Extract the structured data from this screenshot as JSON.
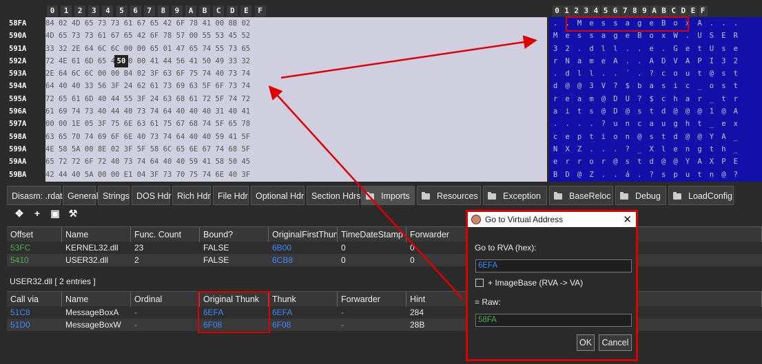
{
  "hex_header": [
    "0",
    "1",
    "2",
    "3",
    "4",
    "5",
    "6",
    "7",
    "8",
    "9",
    "A",
    "B",
    "C",
    "D",
    "E",
    "F"
  ],
  "hex_rows": [
    {
      "offset": "58FA",
      "bytes": "84 02 4D 65 73 73 61 67 65 42 6F 78 41 00 8B 02",
      "ascii": ". . M e s s a g e B o x A . . ."
    },
    {
      "offset": "590A",
      "bytes": "4D 65 73 73 61 67 65 42 6F 78 57 00 55 53 45 52",
      "ascii": "M e s s a g e B o x W . U S E R"
    },
    {
      "offset": "591A",
      "bytes": "33 32 2E 64 6C 6C 00 00 65 01 47 65 74 55 73 65",
      "ascii": "3 2 . d l l . . e . G e t U s e"
    },
    {
      "offset": "592A",
      "bytes": "72 4E 61 6D 65 41 50 00 41 44 56 41 50 49 33 32",
      "ascii": "r N a m e A . . A D V A P I 3 2"
    },
    {
      "offset": "593A",
      "bytes": "2E 64 6C 6C 00 00 B4 02 3F 63 6F 75 74 40 73 74",
      "ascii": ". d l l . . ´ . ? c o u t @ s t"
    },
    {
      "offset": "594A",
      "bytes": "64 40 40 33 56 3F 24 62 61 73 69 63 5F 6F 73 74",
      "ascii": "d @ @ 3 V ? $ b a s i c _ o s t"
    },
    {
      "offset": "595A",
      "bytes": "72 65 61 6D 40 44 55 3F 24 63 68 61 72 5F 74 72",
      "ascii": "r e a m @ D U ? $ c h a r _ t r"
    },
    {
      "offset": "596A",
      "bytes": "61 69 74 73 40 44 40 73 74 64 40 40 40 31 40 41",
      "ascii": "a i t s @ D @ s t d @ @ @ 1 @ A"
    },
    {
      "offset": "597A",
      "bytes": "00 00 1E 05 3F 75 6E 63 61 75 67 68 74 5F 65 78",
      "ascii": ". . . . ? u n c a u g h t _ e x"
    },
    {
      "offset": "598A",
      "bytes": "63 65 70 74 69 6F 6E 40 73 74 64 40 40 59 41 5F",
      "ascii": "c e p t i o n @ s t d @ @ Y A _"
    },
    {
      "offset": "599A",
      "bytes": "4E 58 5A 00 8E 02 3F 5F 58 6C 65 6E 67 74 68 5F",
      "ascii": "N X Z . . . ? _ X l e n g t h _"
    },
    {
      "offset": "59AA",
      "bytes": "65 72 72 6F 72 40 73 74 64 40 40 59 41 58 50 45",
      "ascii": "e r r o r @ s t d @ @ Y A X P E"
    },
    {
      "offset": "59BA",
      "bytes": "42 44 40 5A 00 00 E1 04 3F 73 70 75 74 6E 40 3F",
      "ascii": "B D @ Z . . á . ? s p u t n @ ?"
    }
  ],
  "hex_selected": "50",
  "tabs": [
    {
      "label": "Disasm: .rdata",
      "folder": false
    },
    {
      "label": "General",
      "folder": false
    },
    {
      "label": "Strings",
      "folder": false
    },
    {
      "label": "DOS Hdr",
      "folder": false
    },
    {
      "label": "Rich Hdr",
      "folder": false
    },
    {
      "label": "File Hdr",
      "folder": false
    },
    {
      "label": "Optional Hdr",
      "folder": false
    },
    {
      "label": "Section Hdrs",
      "folder": false
    },
    {
      "label": "Imports",
      "folder": true
    },
    {
      "label": "Resources",
      "folder": true
    },
    {
      "label": "Exception",
      "folder": true
    },
    {
      "label": "BaseReloc",
      "folder": true
    },
    {
      "label": "Debug",
      "folder": true
    },
    {
      "label": "LoadConfig",
      "folder": true
    }
  ],
  "imports_table": {
    "headers": [
      "Offset",
      "Name",
      "Func. Count",
      "Bound?",
      "OriginalFirstThun",
      "TimeDateStamp",
      "Forwarder"
    ],
    "rows": [
      [
        "53FC",
        "KERNEL32.dll",
        "23",
        "FALSE",
        "6B00",
        "0",
        "0"
      ],
      [
        "5410",
        "USER32.dll",
        "2",
        "FALSE",
        "6CB8",
        "0",
        "0"
      ]
    ]
  },
  "sub_label": "USER32.dll   [ 2 entries ]",
  "funcs_table": {
    "headers": [
      "Call via",
      "Name",
      "Ordinal",
      "Original Thunk",
      "Thunk",
      "Forwarder",
      "Hint"
    ],
    "rows": [
      [
        "51C8",
        "MessageBoxA",
        "-",
        "6EFA",
        "6EFA",
        "-",
        "284"
      ],
      [
        "51D0",
        "MessageBoxW",
        "-",
        "6F08",
        "6F08",
        "-",
        "28B"
      ]
    ]
  },
  "dialog": {
    "title": "Go to Virtual Address",
    "rva_label": "Go to RVA (hex):",
    "rva_value": "6EFA",
    "checkbox_label": "+ ImageBase (RVA -> VA)",
    "raw_label": "= Raw:",
    "raw_value": "58FA",
    "ok": "OK",
    "cancel": "Cancel"
  },
  "toolbar_icons": [
    "move-icon",
    "plus-icon",
    "save-icon",
    "wand-icon"
  ],
  "colors": {
    "annotation": "#e00000",
    "ascii_bg": "#1111aa",
    "hex_bg": "#cfcfdf",
    "link_blue": "#3d8bff",
    "offset_green": "#4caf50"
  }
}
